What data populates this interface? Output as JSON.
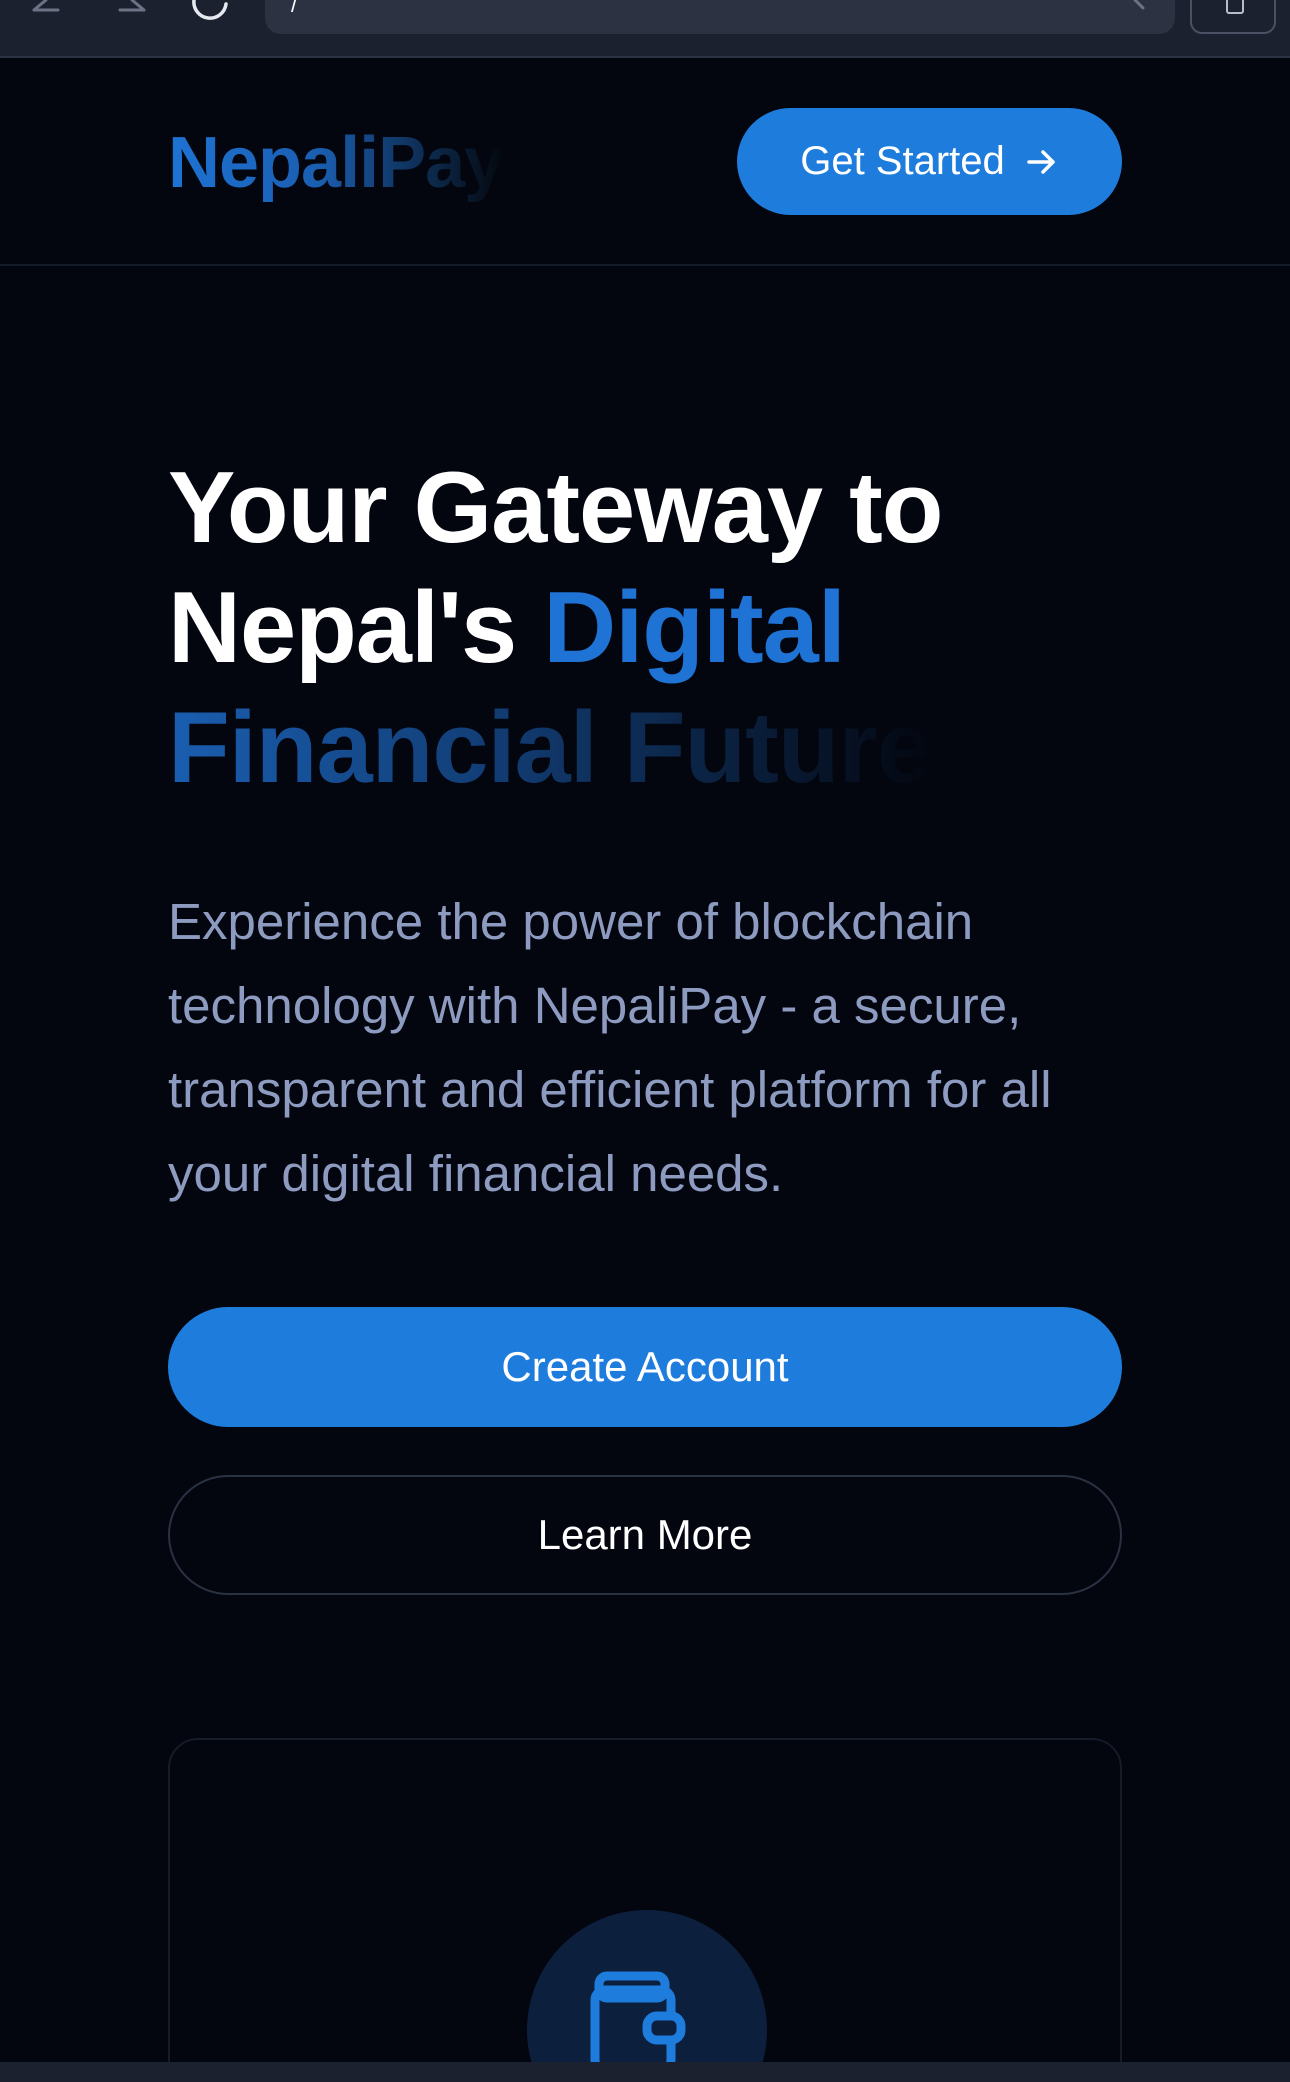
{
  "browser": {
    "url": "/",
    "icons": [
      "back-arrow-icon",
      "forward-arrow-icon",
      "reload-icon",
      "chevron-right-icon",
      "tabs-icon"
    ]
  },
  "header": {
    "brand": "NepaliPay",
    "cta_label": "Get Started",
    "cta_icon": "arrow-right-icon"
  },
  "hero": {
    "title_line1": "Your Gateway to",
    "title_line2_white": "Nepal's ",
    "title_line2_accent": "Digital",
    "title_line3": "Financial Future",
    "description": "Experience the power of blockchain technology with NepaliPay - a secure, transparent and efficient platform for all your digital financial needs.",
    "primary_button": "Create Account",
    "secondary_button": "Learn More"
  },
  "card": {
    "icon": "wallet-icon"
  },
  "colors": {
    "background": "#03060f",
    "accent": "#1e7ddc",
    "brand_blue": "#1e73d4",
    "muted_text": "#8e9bc0",
    "icon_circle": "#0c1f3d"
  }
}
